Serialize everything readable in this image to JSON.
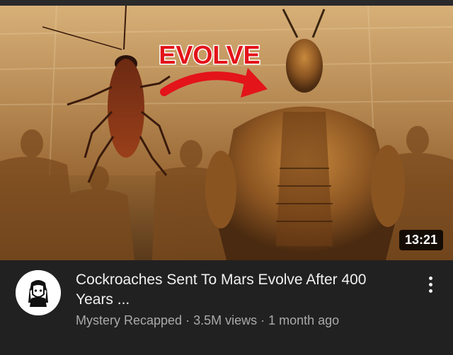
{
  "video": {
    "thumbnail_overlay_text": "EVOLVE",
    "duration": "13:21",
    "title": "Cockroaches Sent To Mars Evolve After 400 Years ...",
    "channel": "Mystery Recapped",
    "views": "3.5M views",
    "age": "1 month ago",
    "separator": "·"
  },
  "colors": {
    "background": "#212121",
    "title_text": "#f1f1f1",
    "meta_text": "#aaaaaa",
    "overlay_red": "#e3141a"
  },
  "icons": {
    "more": "vertical-ellipsis-icon",
    "avatar": "channel-avatar-icon"
  }
}
